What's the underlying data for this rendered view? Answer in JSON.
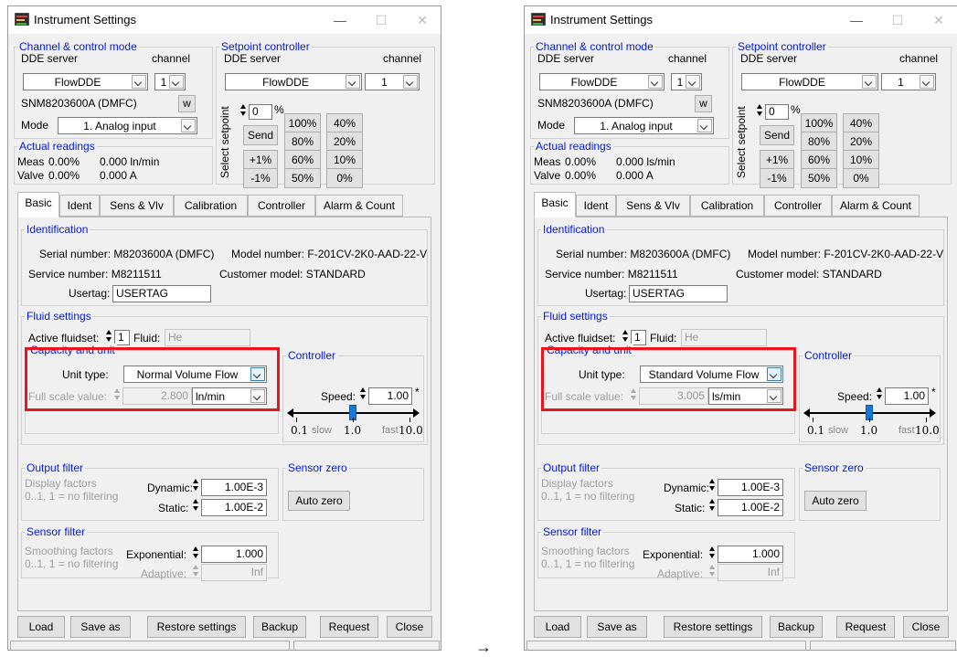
{
  "arrow": "→",
  "windows": [
    {
      "title": "Instrument Settings",
      "titlebar": {
        "min": "—",
        "max": "☐",
        "close": "✕"
      },
      "channel_group": "Channel & control mode",
      "dde_server_label": "DDE server",
      "channel_label": "channel",
      "dde_server": "FlowDDE",
      "channel": "1",
      "device": "SNM8203600A (DMFC)",
      "w_button": "w",
      "mode_label": "Mode",
      "mode": "1. Analog input",
      "setpoint_group": "Setpoint controller",
      "sp_dde_server_label": "DDE server",
      "sp_channel_label": "channel",
      "sp_dde_server": "FlowDDE",
      "sp_channel": "1",
      "select_setpoint": "Select setpoint",
      "setpoint_value": "0",
      "setpoint_unit": "%",
      "send": "Send",
      "setpoint_buttons": [
        "100%",
        "40%",
        "80%",
        "20%",
        "+1%",
        "60%",
        "10%",
        "-1%",
        "50%",
        "0%"
      ],
      "actual_group": "Actual readings",
      "meas_label": "Meas",
      "meas_pct": "0.00%",
      "meas_val": "0.000 ln/min",
      "valve_label": "Valve",
      "valve_pct": "0.00%",
      "valve_val": "0.000 A",
      "tabs": [
        "Basic",
        "Ident",
        "Sens & Vlv",
        "Calibration",
        "Controller",
        "Alarm & Count"
      ],
      "identification": "Identification",
      "serial_number": "Serial number: M8203600A (DMFC)",
      "model_number": "Model number: F-201CV-2K0-AAD-22-V",
      "service_number": "Service number: M8211511",
      "customer_model": "Customer model: STANDARD",
      "usertag_label": "Usertag:",
      "usertag": "USERTAG",
      "fluid_settings": "Fluid settings",
      "active_fluidset_label": "Active fluidset:",
      "active_fluidset": "1",
      "fluid_label": "Fluid:",
      "fluid": "He",
      "capacity_unit": "Capacity and unit",
      "unit_type_label": "Unit type:",
      "unit_type": "Normal Volume Flow",
      "full_scale_label": "Full scale value:",
      "full_scale_value": "2.800",
      "full_scale_unit": "ln/min",
      "controller_group": "Controller",
      "speed_label": "Speed:",
      "speed": "1.00",
      "speed_star": "*",
      "slider_position": 0.5,
      "slider_ticks": [
        "0.1",
        "1.0",
        "10.0"
      ],
      "slider_words": [
        "slow",
        "fast"
      ],
      "output_filter": "Output filter",
      "display_factors": "Display factors",
      "display_hint": "0..1, 1 = no filtering",
      "dynamic_label": "Dynamic:",
      "dynamic": "1.00E-3",
      "static_label": "Static:",
      "static": "1.00E-2",
      "sensor_zero": "Sensor zero",
      "auto_zero": "Auto zero",
      "sensor_filter": "Sensor filter",
      "smoothing_factors": "Smoothing factors",
      "smoothing_hint": "0..1, 1 = no filtering",
      "exponential_label": "Exponential:",
      "exponential": "1.000",
      "adaptive_label": "Adaptive:",
      "adaptive": "Inf",
      "bottom_buttons": [
        "Load",
        "Save as",
        "Restore settings",
        "Backup",
        "Request",
        "Close"
      ]
    },
    {
      "title": "Instrument Settings",
      "titlebar": {
        "min": "—",
        "max": "☐",
        "close": "✕"
      },
      "channel_group": "Channel & control mode",
      "dde_server_label": "DDE server",
      "channel_label": "channel",
      "dde_server": "FlowDDE",
      "channel": "1",
      "device": "SNM8203600A (DMFC)",
      "w_button": "w",
      "mode_label": "Mode",
      "mode": "1. Analog input",
      "setpoint_group": "Setpoint controller",
      "sp_dde_server_label": "DDE server",
      "sp_channel_label": "channel",
      "sp_dde_server": "FlowDDE",
      "sp_channel": "1",
      "select_setpoint": "Select setpoint",
      "setpoint_value": "0",
      "setpoint_unit": "%",
      "send": "Send",
      "setpoint_buttons": [
        "100%",
        "40%",
        "80%",
        "20%",
        "+1%",
        "60%",
        "10%",
        "-1%",
        "50%",
        "0%"
      ],
      "actual_group": "Actual readings",
      "meas_label": "Meas",
      "meas_pct": "0.00%",
      "meas_val": "0.000 ls/min",
      "valve_label": "Valve",
      "valve_pct": "0.00%",
      "valve_val": "0.000 A",
      "tabs": [
        "Basic",
        "Ident",
        "Sens & Vlv",
        "Calibration",
        "Controller",
        "Alarm & Count"
      ],
      "identification": "Identification",
      "serial_number": "Serial number: M8203600A (DMFC)",
      "model_number": "Model number: F-201CV-2K0-AAD-22-V",
      "service_number": "Service number: M8211511",
      "customer_model": "Customer model: STANDARD",
      "usertag_label": "Usertag:",
      "usertag": "USERTAG",
      "fluid_settings": "Fluid settings",
      "active_fluidset_label": "Active fluidset:",
      "active_fluidset": "1",
      "fluid_label": "Fluid:",
      "fluid": "He",
      "capacity_unit": "Capacity and unit",
      "unit_type_label": "Unit type:",
      "unit_type": "Standard Volume Flow",
      "full_scale_label": "Full scale value:",
      "full_scale_value": "3.005",
      "full_scale_unit": "ls/min",
      "controller_group": "Controller",
      "speed_label": "Speed:",
      "speed": "1.00",
      "speed_star": "*",
      "slider_position": 0.5,
      "slider_ticks": [
        "0.1",
        "1.0",
        "10.0"
      ],
      "slider_words": [
        "slow",
        "fast"
      ],
      "output_filter": "Output filter",
      "display_factors": "Display factors",
      "display_hint": "0..1, 1 = no filtering",
      "dynamic_label": "Dynamic:",
      "dynamic": "1.00E-3",
      "static_label": "Static:",
      "static": "1.00E-2",
      "sensor_zero": "Sensor zero",
      "auto_zero": "Auto zero",
      "sensor_filter": "Sensor filter",
      "smoothing_factors": "Smoothing factors",
      "smoothing_hint": "0..1, 1 = no filtering",
      "exponential_label": "Exponential:",
      "exponential": "1.000",
      "adaptive_label": "Adaptive:",
      "adaptive": "Inf",
      "bottom_buttons": [
        "Load",
        "Save as",
        "Restore settings",
        "Backup",
        "Request",
        "Close"
      ]
    }
  ]
}
